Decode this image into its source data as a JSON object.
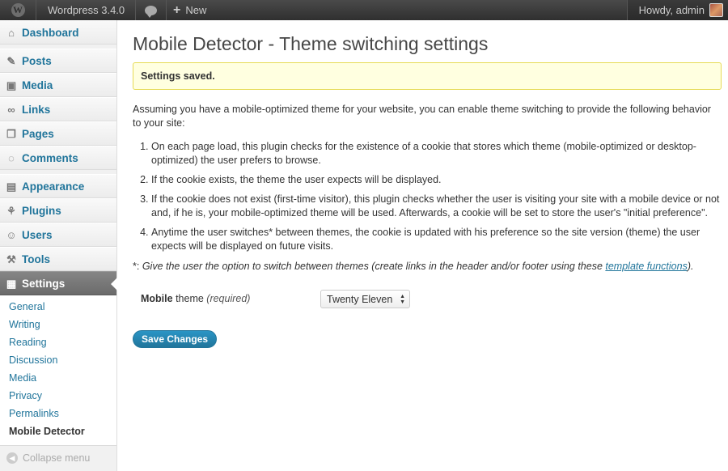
{
  "adminbar": {
    "site_name": "Wordpress 3.4.0",
    "new_label": "New",
    "howdy": "Howdy, admin"
  },
  "sidebar": {
    "items": [
      {
        "label": "Dashboard",
        "icon": "dashboard-icon"
      },
      {
        "label": "Posts",
        "icon": "pin-icon"
      },
      {
        "label": "Media",
        "icon": "media-icon"
      },
      {
        "label": "Links",
        "icon": "link-icon"
      },
      {
        "label": "Pages",
        "icon": "pages-icon"
      },
      {
        "label": "Comments",
        "icon": "comment-icon"
      },
      {
        "label": "Appearance",
        "icon": "appearance-icon"
      },
      {
        "label": "Plugins",
        "icon": "plugin-icon"
      },
      {
        "label": "Users",
        "icon": "users-icon"
      },
      {
        "label": "Tools",
        "icon": "tools-icon"
      },
      {
        "label": "Settings",
        "icon": "settings-icon"
      }
    ],
    "submenu": [
      "General",
      "Writing",
      "Reading",
      "Discussion",
      "Media",
      "Privacy",
      "Permalinks",
      "Mobile Detector"
    ],
    "collapse_label": "Collapse menu"
  },
  "main": {
    "title": "Mobile Detector - Theme switching settings",
    "notice": "Settings saved.",
    "intro": "Assuming you have a mobile-optimized theme for your website, you can enable theme switching to provide the following behavior to your site:",
    "steps": [
      "On each page load, this plugin checks for the existence of a cookie that stores which theme (mobile-optimized or desktop-optimized) the user prefers to browse.",
      "If the cookie exists, the theme the user expects will be displayed.",
      "If the cookie does not exist (first-time visitor), this plugin checks whether the user is visiting your site with a mobile device or not and, if he is, your mobile-optimized theme will be used. Afterwards, a cookie will be set to store the user's \"initial preference\".",
      "Anytime the user switches* between themes, the cookie is updated with his preference so the site version (theme) the user expects will be displayed on future visits."
    ],
    "footnote_prefix": "*: ",
    "footnote_text": "Give the user the option to switch between themes (create links in the header and/or footer using these ",
    "footnote_link": "template functions",
    "footnote_suffix": ").",
    "field_label_bold": "Mobile",
    "field_label_rest": " theme ",
    "field_required": "(required)",
    "theme_select_value": "Twenty Eleven",
    "save_button": "Save Changes"
  },
  "colors": {
    "link": "#21759b",
    "notice_bg": "#ffffe0",
    "notice_border": "#e6db55",
    "current_menu": "#6b6b6b"
  }
}
